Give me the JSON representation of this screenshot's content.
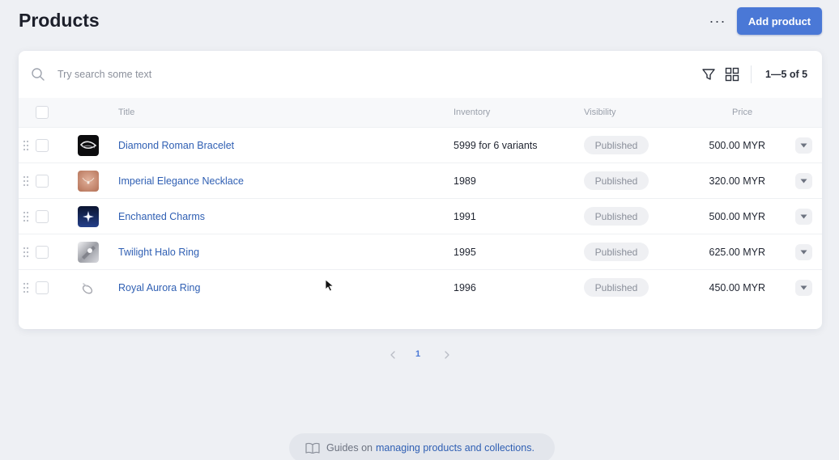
{
  "header": {
    "title": "Products",
    "more_label": "···",
    "add_label": "Add product"
  },
  "toolbar": {
    "search_placeholder": "Try search some text",
    "range_text": "1—5 of 5"
  },
  "table": {
    "columns": {
      "title": "Title",
      "inventory": "Inventory",
      "visibility": "Visibility",
      "price": "Price"
    },
    "rows": [
      {
        "title": "Diamond Roman Bracelet",
        "inventory": "5999 for 6 variants",
        "visibility": "Published",
        "price": "500.00 MYR"
      },
      {
        "title": "Imperial Elegance Necklace",
        "inventory": "1989",
        "visibility": "Published",
        "price": "320.00 MYR"
      },
      {
        "title": "Enchanted Charms",
        "inventory": "1991",
        "visibility": "Published",
        "price": "500.00 MYR"
      },
      {
        "title": "Twilight Halo Ring",
        "inventory": "1995",
        "visibility": "Published",
        "price": "625.00 MYR"
      },
      {
        "title": "Royal Aurora Ring",
        "inventory": "1996",
        "visibility": "Published",
        "price": "450.00 MYR"
      }
    ]
  },
  "pagination": {
    "current": "1"
  },
  "guide": {
    "prefix": "Guides on",
    "link": "managing products and collections."
  },
  "colors": {
    "accent": "#4a78d6",
    "link": "#2f5fb3",
    "background": "#eef0f4"
  }
}
